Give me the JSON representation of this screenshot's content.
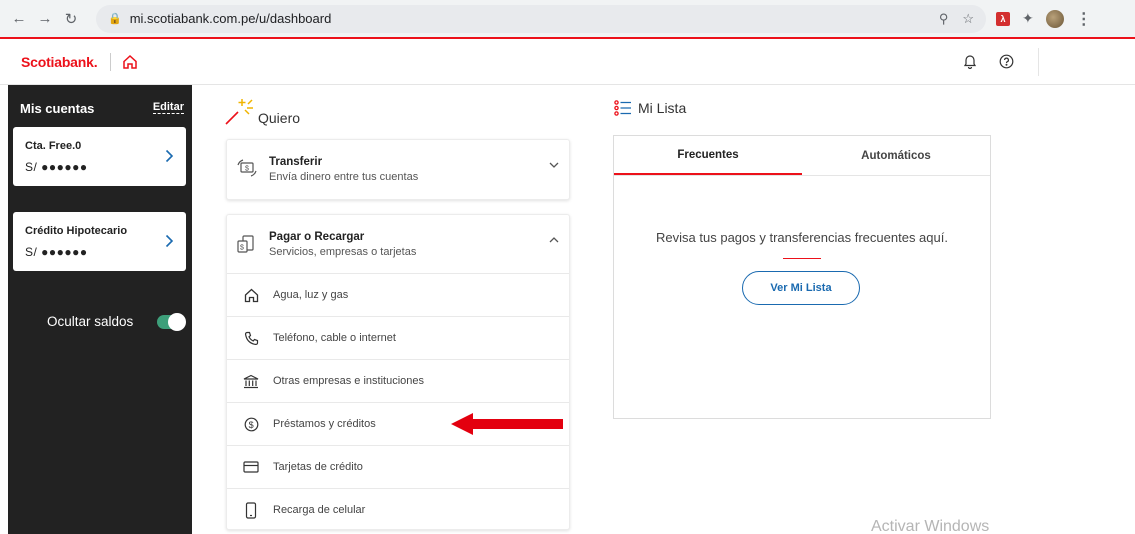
{
  "browser": {
    "url": "mi.scotiabank.com.pe/u/dashboard"
  },
  "header": {
    "brand": "Scotiabank."
  },
  "sidebar": {
    "title": "Mis cuentas",
    "edit_label": "Editar",
    "accounts": [
      {
        "name": "Cta. Free.0",
        "balance": "S/ ●●●●●●"
      },
      {
        "name": "Crédito Hipotecario",
        "balance": "S/ ●●●●●●"
      }
    ],
    "hide_balances_label": "Ocultar saldos",
    "hide_balances_on": true
  },
  "quiero": {
    "title": "Quiero",
    "transferir": {
      "title": "Transferir",
      "subtitle": "Envía dinero entre tus cuentas",
      "expanded": false
    },
    "pagar": {
      "title": "Pagar o Recargar",
      "subtitle": "Servicios, empresas o tarjetas",
      "expanded": true,
      "options": [
        {
          "label": "Agua, luz y gas",
          "icon": "home-icon"
        },
        {
          "label": "Teléfono, cable o internet",
          "icon": "phone-icon"
        },
        {
          "label": "Otras empresas e instituciones",
          "icon": "institution-icon"
        },
        {
          "label": "Préstamos y créditos",
          "icon": "dollar-coin-icon"
        },
        {
          "label": "Tarjetas de crédito",
          "icon": "credit-card-icon"
        },
        {
          "label": "Recarga de celular",
          "icon": "mobile-phone-icon"
        }
      ]
    }
  },
  "mi_lista": {
    "title": "Mi Lista",
    "tabs": [
      "Frecuentes",
      "Automáticos"
    ],
    "active_tab": "Frecuentes",
    "message": "Revisa tus pagos y transferencias frecuentes aquí.",
    "button_label": "Ver Mi Lista"
  },
  "overlay": {
    "watermark": "Activar Windows"
  },
  "colors": {
    "brand_red": "#ec111a",
    "link_blue": "#1a6ab0",
    "sidebar_bg": "#222222",
    "toggle_green": "#3d9f7a",
    "annotation_arrow": "#e3000f"
  }
}
